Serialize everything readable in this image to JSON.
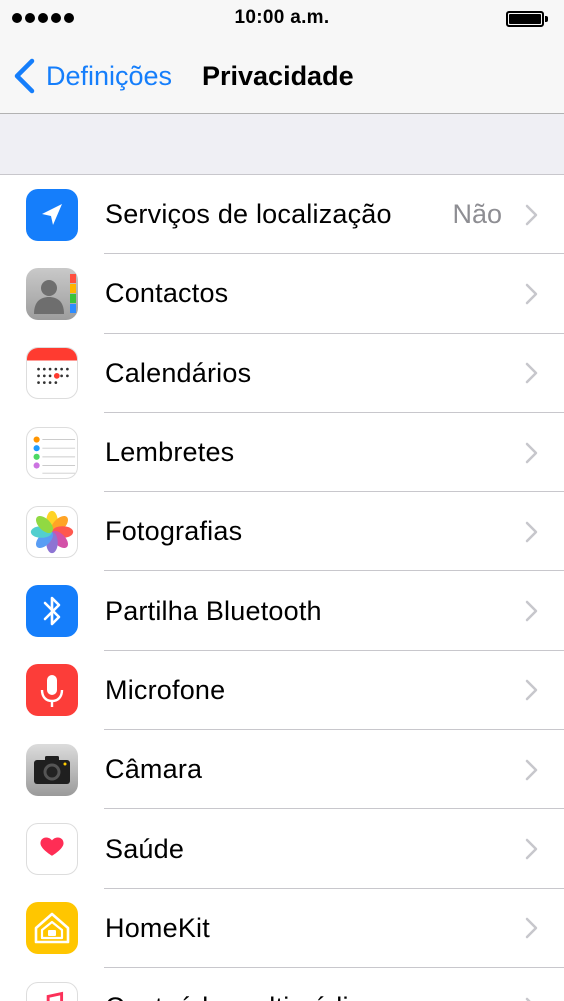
{
  "status_bar": {
    "time": "10:00 a.m.",
    "signal_bars": 5
  },
  "nav": {
    "back_label": "Definições",
    "title": "Privacidade"
  },
  "colors": {
    "accent": "#157efb",
    "separator": "#c8c7cc",
    "group_background": "#efeff4",
    "secondary_text": "#8e8e93"
  },
  "items": [
    {
      "label": "Serviços de localização",
      "value": "Não",
      "icon": "location-arrow-icon"
    },
    {
      "label": "Contactos",
      "icon": "contacts-icon"
    },
    {
      "label": "Calendários",
      "icon": "calendar-icon"
    },
    {
      "label": "Lembretes",
      "icon": "reminders-icon"
    },
    {
      "label": "Fotografias",
      "icon": "photos-icon"
    },
    {
      "label": "Partilha Bluetooth",
      "icon": "bluetooth-icon"
    },
    {
      "label": "Microfone",
      "icon": "microphone-icon"
    },
    {
      "label": "Câmara",
      "icon": "camera-icon"
    },
    {
      "label": "Saúde",
      "icon": "health-heart-icon"
    },
    {
      "label": "HomeKit",
      "icon": "homekit-icon"
    },
    {
      "label": "Conteúdo multimédia",
      "icon": "music-note-icon"
    }
  ]
}
